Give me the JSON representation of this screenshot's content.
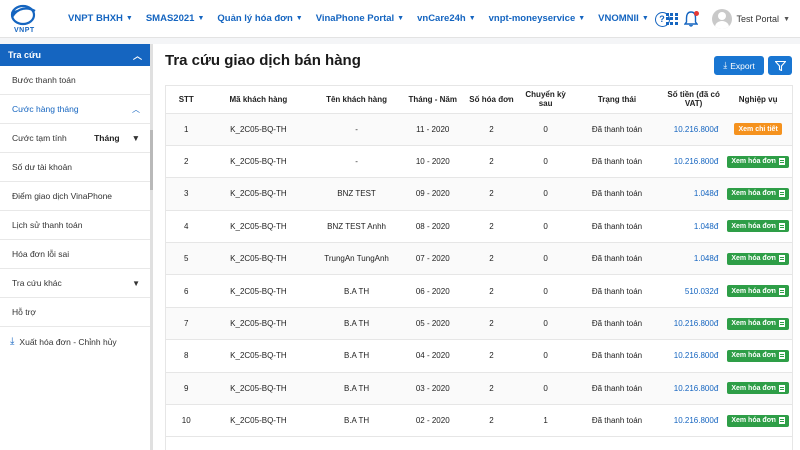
{
  "brand": {
    "logo_text": "VNPT",
    "color": "#1565c0"
  },
  "nav": [
    {
      "label": "VNPT BHXH"
    },
    {
      "label": "SMAS2021"
    },
    {
      "label": "Quản lý hóa đơn"
    },
    {
      "label": "VinaPhone Portal"
    },
    {
      "label": "vnCare24h"
    },
    {
      "label": "vnpt-moneyservice"
    },
    {
      "label": "VNOMNII"
    }
  ],
  "user": {
    "name": "Test Portal"
  },
  "sidebar": {
    "header": "Tra cứu",
    "items": [
      {
        "label": "Bước thanh toán"
      },
      {
        "label": "Cước hàng tháng"
      },
      {
        "label": "Cước tạm tính",
        "select_value": "Tháng"
      },
      {
        "label": "Số dư tài khoản"
      },
      {
        "label": "Điểm giao dịch VinaPhone"
      },
      {
        "label": "Lịch sử thanh toán"
      },
      {
        "label": "Hóa đơn lỗi sai"
      },
      {
        "label": "Tra cứu khác"
      },
      {
        "label": "Hỗ trợ"
      }
    ],
    "export_label": "Xuất hóa đơn - Chỉnh hủy"
  },
  "main": {
    "title": "Tra cứu giao dịch bán hàng",
    "export_label": "Export"
  },
  "table": {
    "headers": [
      "STT",
      "Mã khách hàng",
      "Tên khách hàng",
      "Tháng - Năm",
      "Số hóa đơn",
      "Chuyển kỳ sau",
      "Trạng thái",
      "Số tiền (đã có VAT)",
      "Nghiệp vụ"
    ],
    "rows": [
      {
        "stt": "1",
        "code": "K_2C05-BQ-TH",
        "name": "-",
        "period": "11 - 2020",
        "invoices": "2",
        "carry": "0",
        "status": "Đã thanh toán",
        "amount": "10.216.800đ",
        "action": "Xem chi tiết",
        "action_type": "orange"
      },
      {
        "stt": "2",
        "code": "K_2C05-BQ-TH",
        "name": "-",
        "period": "10 - 2020",
        "invoices": "2",
        "carry": "0",
        "status": "Đã thanh toán",
        "amount": "10.216.800đ",
        "action": "Xem hóa đơn",
        "action_type": "green"
      },
      {
        "stt": "3",
        "code": "K_2C05-BQ-TH",
        "name": "BNZ TEST",
        "period": "09 - 2020",
        "invoices": "2",
        "carry": "0",
        "status": "Đã thanh toán",
        "amount": "1.048đ",
        "action": "Xem hóa đơn",
        "action_type": "green"
      },
      {
        "stt": "4",
        "code": "K_2C05-BQ-TH",
        "name": "BNZ TEST Anhh",
        "period": "08 - 2020",
        "invoices": "2",
        "carry": "0",
        "status": "Đã thanh toán",
        "amount": "1.048đ",
        "action": "Xem hóa đơn",
        "action_type": "green"
      },
      {
        "stt": "5",
        "code": "K_2C05-BQ-TH",
        "name": "TrungAn TungAnh",
        "period": "07 - 2020",
        "invoices": "2",
        "carry": "0",
        "status": "Đã thanh toán",
        "amount": "1.048đ",
        "action": "Xem hóa đơn",
        "action_type": "green"
      },
      {
        "stt": "6",
        "code": "K_2C05-BQ-TH",
        "name": "B.A TH",
        "period": "06 - 2020",
        "invoices": "2",
        "carry": "0",
        "status": "Đã thanh toán",
        "amount": "510.032đ",
        "action": "Xem hóa đơn",
        "action_type": "green"
      },
      {
        "stt": "7",
        "code": "K_2C05-BQ-TH",
        "name": "B.A TH",
        "period": "05 - 2020",
        "invoices": "2",
        "carry": "0",
        "status": "Đã thanh toán",
        "amount": "10.216.800đ",
        "action": "Xem hóa đơn",
        "action_type": "green"
      },
      {
        "stt": "8",
        "code": "K_2C05-BQ-TH",
        "name": "B.A TH",
        "period": "04 - 2020",
        "invoices": "2",
        "carry": "0",
        "status": "Đã thanh toán",
        "amount": "10.216.800đ",
        "action": "Xem hóa đơn",
        "action_type": "green"
      },
      {
        "stt": "9",
        "code": "K_2C05-BQ-TH",
        "name": "B.A TH",
        "period": "03 - 2020",
        "invoices": "2",
        "carry": "0",
        "status": "Đã thanh toán",
        "amount": "10.216.800đ",
        "action": "Xem hóa đơn",
        "action_type": "green"
      },
      {
        "stt": "10",
        "code": "K_2C05-BQ-TH",
        "name": "B.A TH",
        "period": "02 - 2020",
        "invoices": "2",
        "carry": "1",
        "status": "Đã thanh toán",
        "amount": "10.216.800đ",
        "action": "Xem hóa đơn",
        "action_type": "green"
      }
    ]
  }
}
